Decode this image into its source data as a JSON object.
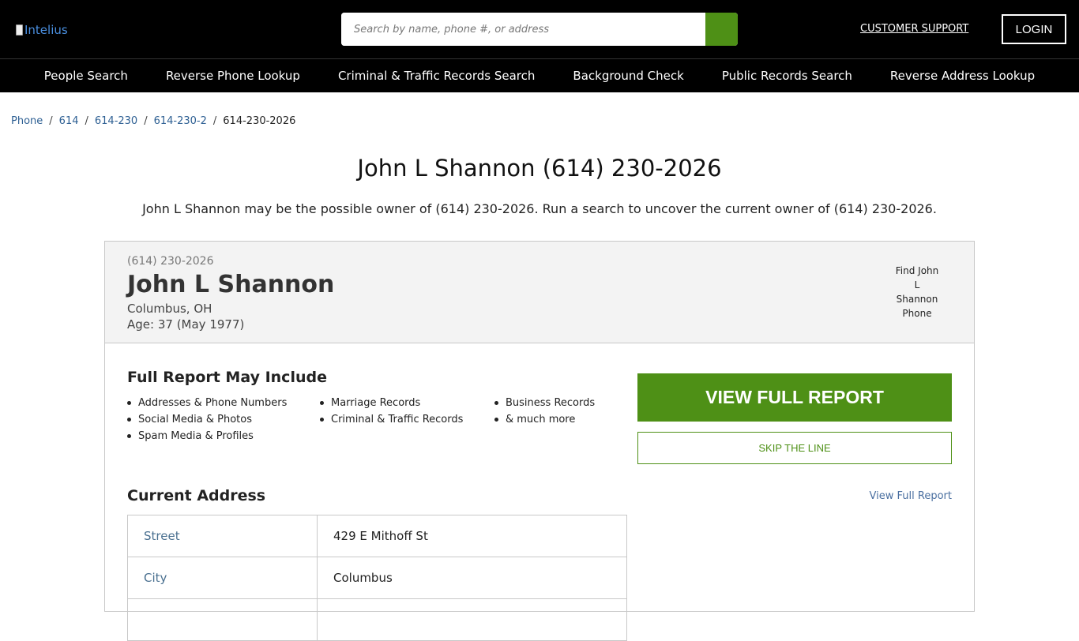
{
  "header": {
    "logo_alt": "Intelius",
    "search_placeholder": "Search by name, phone #, or address",
    "support_label": "CUSTOMER SUPPORT",
    "login_label": "LOGIN"
  },
  "nav": {
    "items": [
      {
        "label": "People Search"
      },
      {
        "label": "Reverse Phone Lookup"
      },
      {
        "label": "Criminal & Traffic Records Search"
      },
      {
        "label": "Background Check"
      },
      {
        "label": "Public Records Search"
      },
      {
        "label": "Reverse Address Lookup"
      }
    ]
  },
  "breadcrumb": {
    "items": [
      "Phone",
      "614",
      "614-230",
      "614-230-2"
    ],
    "current": "614-230-2026",
    "separator": "/"
  },
  "page": {
    "title": "John L Shannon (614) 230-2026",
    "subtitle": "John L Shannon may be the possible owner of (614) 230-2026. Run a search to uncover the current owner of (614) 230-2026."
  },
  "card": {
    "phone": "(614) 230-2026",
    "name": "John L Shannon",
    "location": "Columbus, OH",
    "age": "Age: 37 (May 1977)",
    "image_alt": "Find John L Shannon Phone"
  },
  "report": {
    "section_title": "Full Report May Include",
    "features": [
      [
        "Addresses & Phone Numbers",
        "Social Media & Photos",
        "Spam Media & Profiles"
      ],
      [
        "Marriage Records",
        "Criminal & Traffic Records"
      ],
      [
        "Business Records",
        "& much more"
      ]
    ],
    "view_full_label": "VIEW FULL REPORT",
    "skip_label": "SKIP THE LINE"
  },
  "address": {
    "section_title": "Current Address",
    "view_link": "View Full Report",
    "rows": [
      {
        "key": "Street",
        "value": "429 E Mithoff St"
      },
      {
        "key": "City",
        "value": "Columbus"
      },
      {
        "key": "",
        "value": ""
      }
    ]
  },
  "colors": {
    "brand_green": "#4e9016",
    "header_bg": "#000000",
    "link_blue": "#2d5f93"
  }
}
